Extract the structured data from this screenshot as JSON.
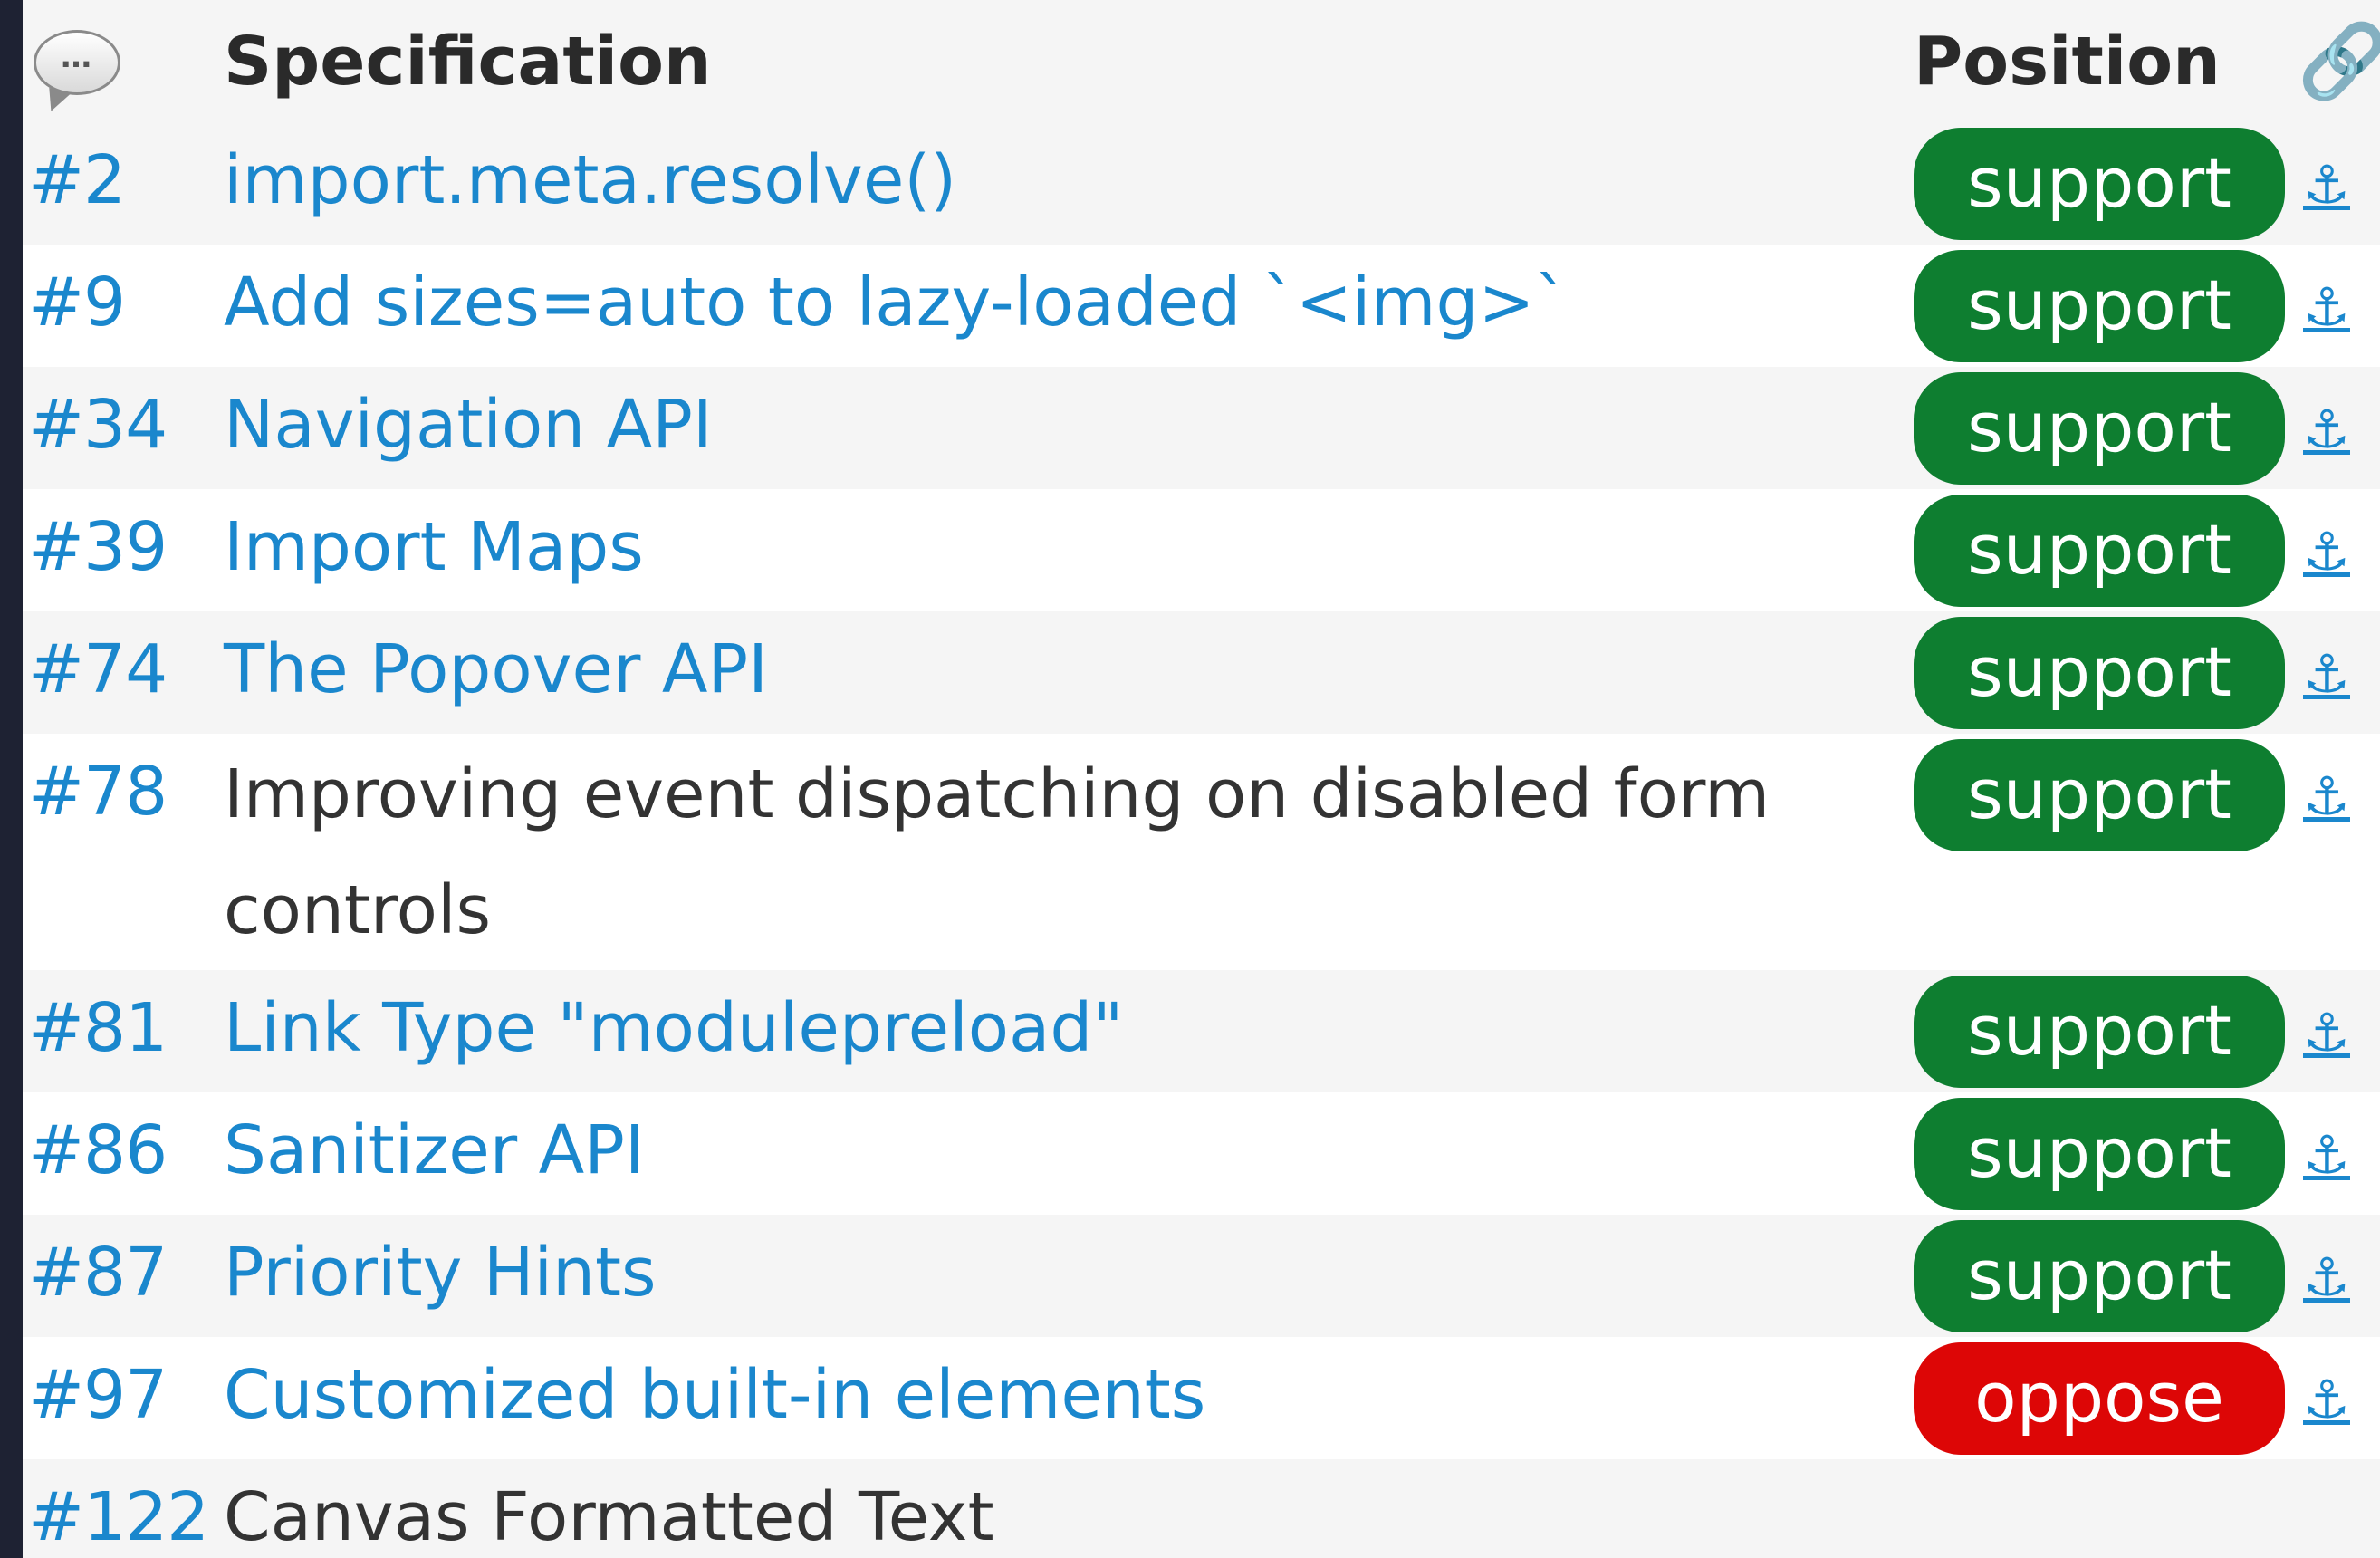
{
  "header": {
    "comment_icon": "speech-bubble-icon",
    "specification": "Specification",
    "position": "Position",
    "link_icon": "chain-link-icon"
  },
  "rows": [
    {
      "num": "#2",
      "spec": "import.meta.resolve()",
      "position": "support",
      "linked": true
    },
    {
      "num": "#9",
      "spec": "Add sizes=auto to lazy-loaded `<img>`",
      "position": "support",
      "linked": true
    },
    {
      "num": "#34",
      "spec": "Navigation API",
      "position": "support",
      "linked": true
    },
    {
      "num": "#39",
      "spec": "Import Maps",
      "position": "support",
      "linked": true
    },
    {
      "num": "#74",
      "spec": "The Popover API",
      "position": "support",
      "linked": true
    },
    {
      "num": "#78",
      "spec": "Improving event dispatching on disabled form controls",
      "position": "support",
      "linked": false
    },
    {
      "num": "#81",
      "spec": "Link Type \"modulepreload\"",
      "position": "support",
      "linked": true
    },
    {
      "num": "#86",
      "spec": "Sanitizer API",
      "position": "support",
      "linked": true
    },
    {
      "num": "#87",
      "spec": "Priority Hints",
      "position": "support",
      "linked": true
    },
    {
      "num": "#97",
      "spec": "Customized built-in elements",
      "position": "oppose",
      "linked": true
    },
    {
      "num": "#122",
      "spec": "Canvas Formatted Text",
      "position": "",
      "linked": false
    }
  ],
  "anchor_glyph": "⚓",
  "colors": {
    "link": "#1a87cd",
    "support": "#0e7e30",
    "oppose": "#dd0606"
  }
}
